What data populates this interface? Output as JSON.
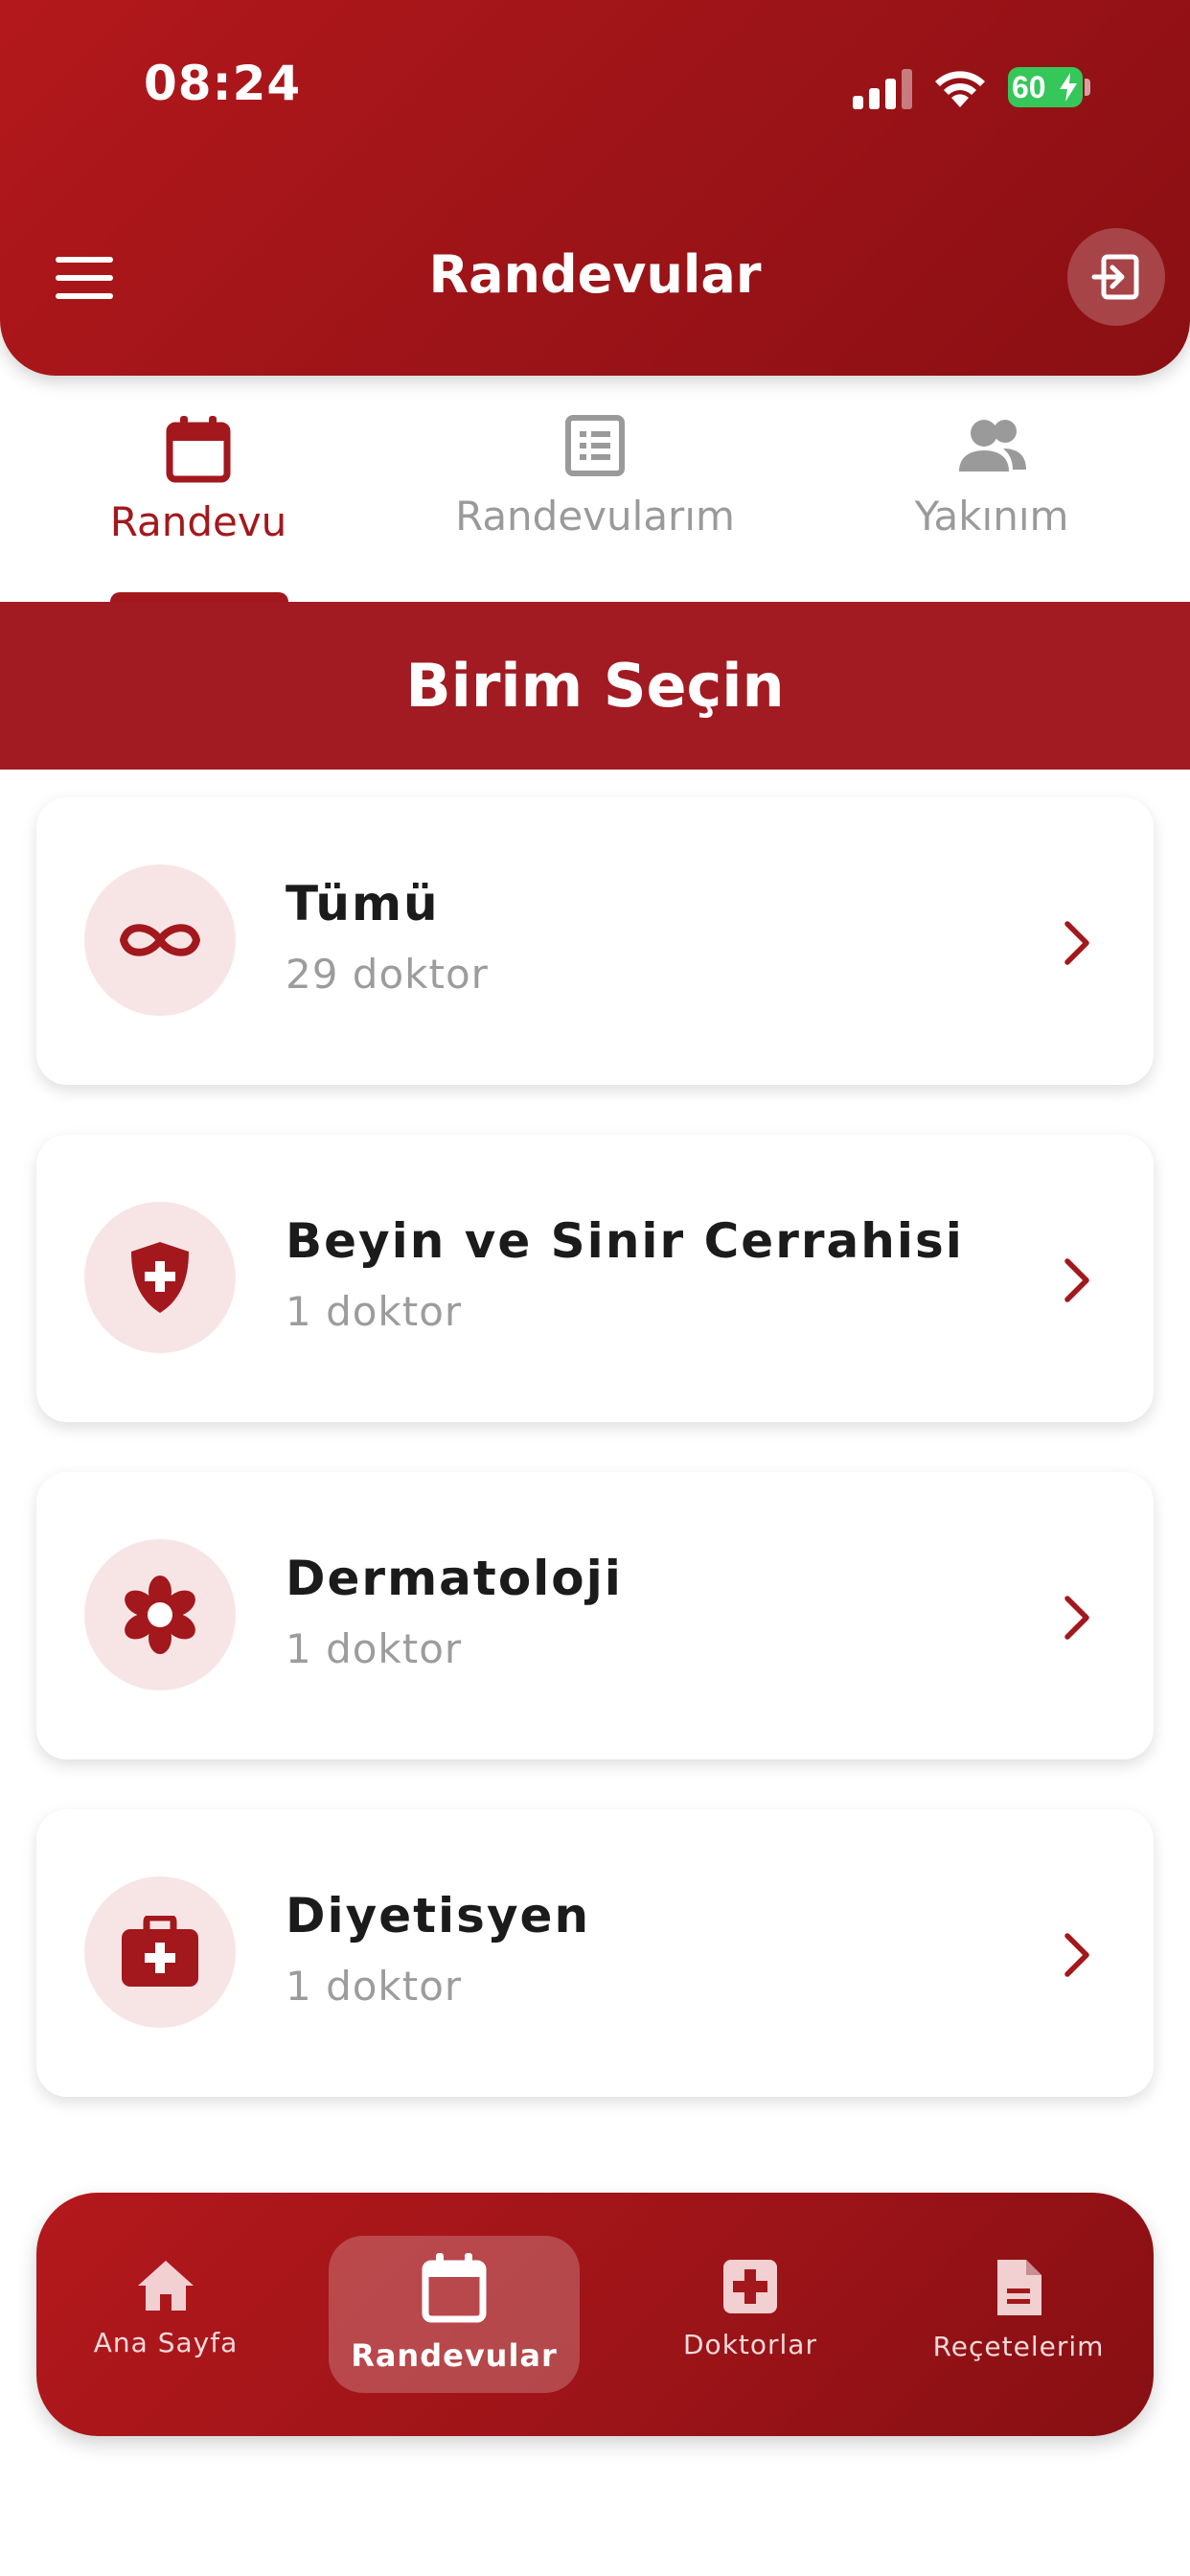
{
  "status_bar": {
    "time": "08:24",
    "battery": "60"
  },
  "header": {
    "title": "Randevular"
  },
  "tabs": [
    {
      "label": "Randevu",
      "icon": "calendar-icon",
      "active": true
    },
    {
      "label": "Randevularım",
      "icon": "list-icon",
      "active": false
    },
    {
      "label": "Yakınım",
      "icon": "people-icon",
      "active": false
    }
  ],
  "section": {
    "title": "Birim Seçin"
  },
  "departments": [
    {
      "title": "Tümü",
      "subtitle": "29 doktor",
      "icon": "infinity-icon"
    },
    {
      "title": "Beyin ve Sinir Cerrahisi",
      "subtitle": "1 doktor",
      "icon": "shield-plus-icon"
    },
    {
      "title": "Dermatoloji",
      "subtitle": "1 doktor",
      "icon": "flower-icon"
    },
    {
      "title": "Diyetisyen",
      "subtitle": "1 doktor",
      "icon": "medkit-icon"
    }
  ],
  "bottom_nav": [
    {
      "label": "Ana Sayfa",
      "icon": "home-icon",
      "active": false
    },
    {
      "label": "Randevular",
      "icon": "calendar-icon",
      "active": true
    },
    {
      "label": "Doktorlar",
      "icon": "medical-cross-icon",
      "active": false
    },
    {
      "label": "Reçetelerim",
      "icon": "document-icon",
      "active": false
    }
  ],
  "colors": {
    "primary": "#a3181c",
    "icon_bg": "#f7e5e6",
    "inactive": "#9a9a9a"
  }
}
